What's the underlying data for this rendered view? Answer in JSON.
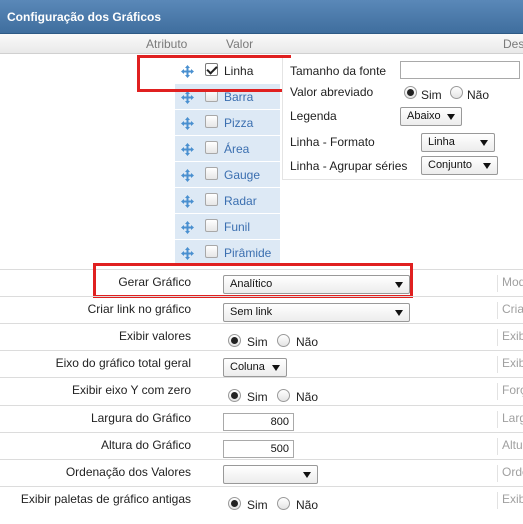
{
  "window": {
    "title": "Configuração dos Gráficos"
  },
  "columns": {
    "attribute": "Atributo",
    "value": "Valor",
    "description": "Des"
  },
  "chart_types": [
    {
      "label": "Linha",
      "checked": true
    },
    {
      "label": "Barra",
      "checked": false
    },
    {
      "label": "Pizza",
      "checked": false
    },
    {
      "label": "Área",
      "checked": false
    },
    {
      "label": "Gauge",
      "checked": false
    },
    {
      "label": "Radar",
      "checked": false
    },
    {
      "label": "Funil",
      "checked": false
    },
    {
      "label": "Pirâmide",
      "checked": false
    }
  ],
  "options": {
    "font_size": {
      "label": "Tamanho da fonte",
      "value": ""
    },
    "abbreviated": {
      "label": "Valor abreviado",
      "yes": "Sim",
      "no": "Não",
      "selected": "Sim"
    },
    "legend": {
      "label": "Legenda",
      "value": "Abaixo"
    },
    "line_format": {
      "label": "Linha - Formato",
      "value": "Linha"
    },
    "line_group": {
      "label": "Linha - Agrupar séries",
      "value": "Conjunto"
    }
  },
  "properties": {
    "generate_chart": {
      "label": "Gerar Gráfico",
      "value": "Analítico",
      "desc": "Mod"
    },
    "create_link": {
      "label": "Criar link no gráfico",
      "value": "Sem link",
      "desc": "Cria"
    },
    "show_values": {
      "label": "Exibir valores",
      "yes": "Sim",
      "no": "Não",
      "desc": "Exib"
    },
    "total_axis": {
      "label": "Eixo do gráfico total geral",
      "value": "Coluna",
      "desc": "Exib"
    },
    "y_zero": {
      "label": "Exibir eixo Y com zero",
      "yes": "Sim",
      "no": "Não",
      "desc": "Forç"
    },
    "width": {
      "label": "Largura do Gráfico",
      "value": "800",
      "desc": "Larg"
    },
    "height": {
      "label": "Altura do Gráfico",
      "value": "500",
      "desc": "Altu"
    },
    "order": {
      "label": "Ordenação dos Valores",
      "value": "",
      "desc": "Orde"
    },
    "old_palettes": {
      "label": "Exibir paletas de gráfico antigas",
      "yes": "Sim",
      "no": "Não",
      "desc": "Exib"
    }
  },
  "colors": {
    "title_bar": "#4a7aab",
    "highlight": "#e02020",
    "list_bg": "#dde9f5",
    "link": "#3b6fb0"
  }
}
